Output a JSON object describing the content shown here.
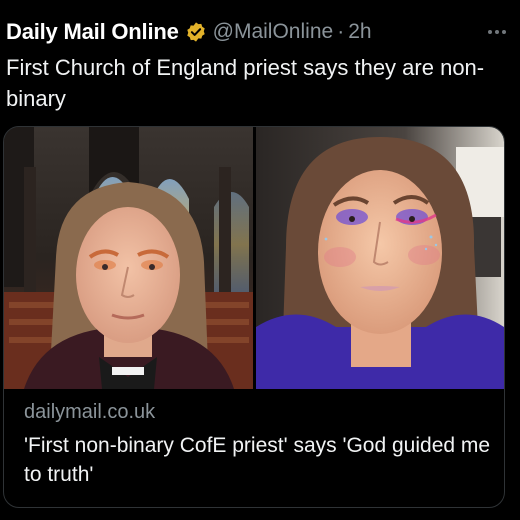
{
  "tweet": {
    "author_name": "Daily Mail Online",
    "handle": "@MailOnline",
    "separator": "·",
    "time": "2h",
    "text": "First Church of England priest says they are non-binary",
    "verified_badge_icon": "verified-badge-icon",
    "more_icon": "more-options-icon"
  },
  "card": {
    "domain": "dailymail.co.uk",
    "title": "'First non-binary CofE priest' says 'God guided me to truth'",
    "images": [
      {
        "alt_name": "priest-in-church-photo"
      },
      {
        "alt_name": "selfie-with-makeup-photo"
      }
    ]
  },
  "colors": {
    "background": "#000000",
    "primary_text": "#e7e9ea",
    "secondary_text": "#8b949a",
    "badge": "#e2b22a",
    "border": "#2f3336"
  }
}
